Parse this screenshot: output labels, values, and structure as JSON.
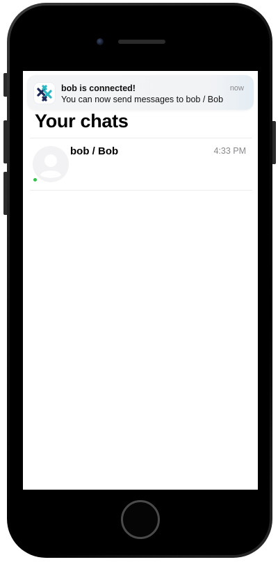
{
  "notification": {
    "app_icon": "simplex-logo-icon",
    "title": "bob is connected!",
    "body": "You can now send messages to bob / Bob",
    "time": "now"
  },
  "chats": {
    "title": "Your chats",
    "items": [
      {
        "name": "bob / Bob",
        "time": "4:33 PM",
        "avatar_icon": "person-placeholder-icon",
        "online": true
      }
    ]
  },
  "colors": {
    "online": "#36c24a",
    "logo_dark": "#1e2a5a",
    "logo_teal": "#2bb8c4"
  }
}
